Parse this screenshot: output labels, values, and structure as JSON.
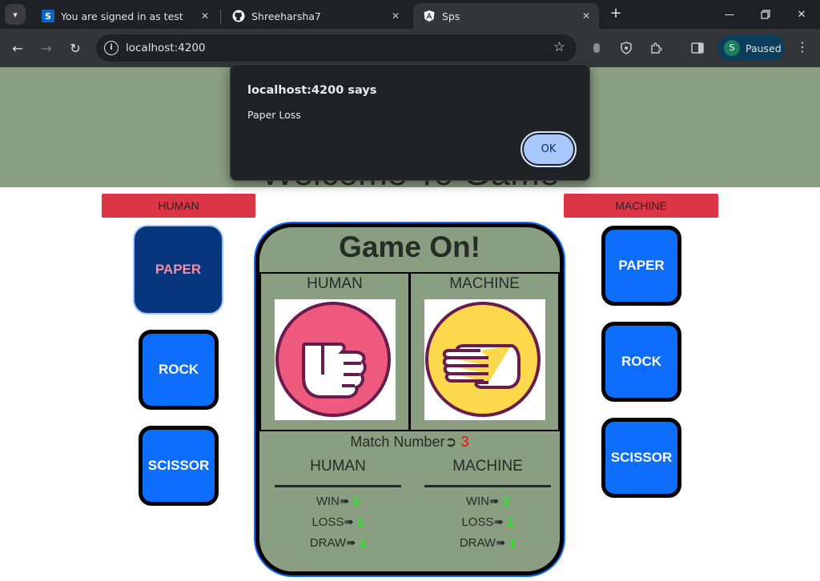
{
  "browser": {
    "tabs": [
      {
        "title": "You are signed in as test",
        "favicon": "S",
        "favicon_color": "#0a66c2"
      },
      {
        "title": "Shreeharsha7",
        "favicon": "github-icon",
        "favicon_color": "#ffffff"
      },
      {
        "title": "Sps",
        "favicon": "angular-icon",
        "favicon_color": "#ffffff"
      }
    ],
    "url": "localhost:4200",
    "profile_initial": "S",
    "profile_label": "Paused"
  },
  "page": {
    "banner_title": "Welcome To Game",
    "human_label": "HUMAN",
    "machine_label": "MACHINE",
    "human_choices": [
      "PAPER",
      "ROCK",
      "SCISSOR"
    ],
    "machine_choices": [
      "PAPER",
      "ROCK",
      "SCISSOR"
    ],
    "selected_human_choice": "PAPER",
    "board": {
      "title": "Game On!",
      "human_header": "HUMAN",
      "machine_header": "MACHINE",
      "human_hand": "rock",
      "machine_hand": "paper",
      "match_label": "Match Number",
      "match_arrow": "➲",
      "match_number": "3",
      "score_human_header": "HUMAN",
      "score_machine_header": "MACHINE",
      "human_scores": [
        {
          "label": "WIN",
          "arrow": "➠",
          "value": "2"
        },
        {
          "label": "LOSS",
          "arrow": "➠",
          "value": "1"
        },
        {
          "label": "DRAW",
          "arrow": "➠",
          "value": "1"
        }
      ],
      "machine_scores": [
        {
          "label": "WIN",
          "arrow": "➠",
          "value": "2"
        },
        {
          "label": "LOSS",
          "arrow": "➠",
          "value": "1"
        },
        {
          "label": "DRAW",
          "arrow": "➠",
          "value": "1"
        }
      ]
    }
  },
  "dialog": {
    "title": "localhost:4200 says",
    "message": "Paper Loss",
    "ok_label": "OK"
  },
  "colors": {
    "banner": "#8a9e81",
    "label_red": "#dc3545",
    "choice_blue": "#0d6efd",
    "selected_dark": "#07367d",
    "score_green": "#22ee22",
    "match_red": "#ff0000"
  }
}
